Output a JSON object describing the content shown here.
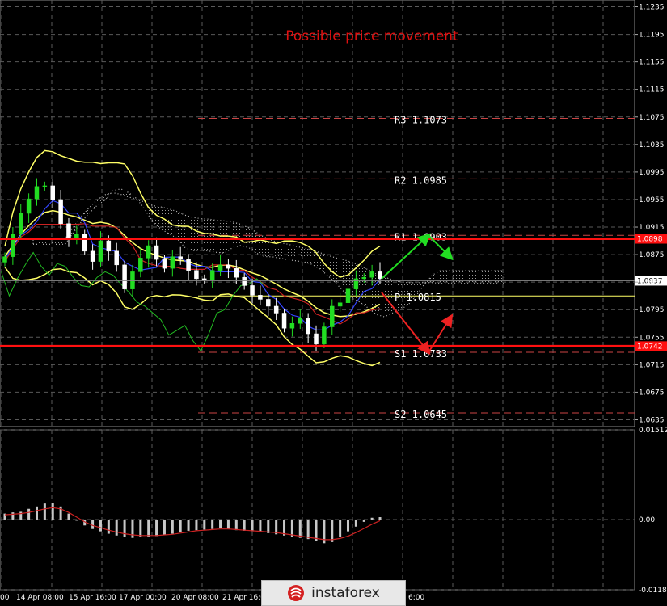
{
  "title": "Possible price movement",
  "colors": {
    "background": "#000000",
    "grid": "#5a5a5a",
    "axis_text": "#ffffff",
    "bull_candle": "#22dd22",
    "bear_candle": "#ffffff",
    "bollinger": "#ffff66",
    "kijun": "#cc2222",
    "tenkan": "#3344ff",
    "chikou": "#22bb22",
    "cloud": "#bbbbbb",
    "pivot_line": "#cc4444",
    "pivot_P": "#ffff66",
    "level_line": "#ff1010",
    "arrow_up": "#22dd22",
    "arrow_down": "#ee2222",
    "osma_bar": "#c8c8c8",
    "osma_signal": "#cc2222"
  },
  "chart_data": [
    {
      "type": "candlestick",
      "title": "Possible price movement",
      "y_ticks": [
        "1.1235",
        "1.1195",
        "1.1155",
        "1.1115",
        "1.1075",
        "1.1035",
        "1.0995",
        "1.0955",
        "1.0915",
        "1.0875",
        "1.0835",
        "1.0795",
        "1.0755",
        "1.0715",
        "1.0675",
        "1.0635"
      ],
      "ylim": [
        1.0625,
        1.1245
      ],
      "x_ticks": [
        "00",
        "14 Apr 08:00",
        "15 Apr 16:00",
        "17 Apr 00:00",
        "20 Apr 08:00",
        "21 Apr 16:00",
        "6:00"
      ],
      "current_price": "1.0837",
      "marked_levels": [
        {
          "label": "1.0898",
          "value": 1.0898
        },
        {
          "label": "1.0742",
          "value": 1.0742
        }
      ],
      "pivot_levels": [
        {
          "name": "R3",
          "value": "1.1073"
        },
        {
          "name": "R2",
          "value": "1.0985"
        },
        {
          "name": "R1",
          "value": "1.0903"
        },
        {
          "name": "P",
          "value": "1.0815"
        },
        {
          "name": "S1",
          "value": "1.0733"
        },
        {
          "name": "S2",
          "value": "1.0645"
        }
      ],
      "close_prices": [
        1.0872,
        1.0905,
        1.0935,
        1.0956,
        1.0974,
        1.0975,
        1.0955,
        1.092,
        1.09,
        1.0905,
        1.088,
        1.0865,
        1.0895,
        1.088,
        1.086,
        1.0825,
        1.085,
        1.087,
        1.0888,
        1.0868,
        1.0855,
        1.0872,
        1.0868,
        1.0852,
        1.084,
        1.0838,
        1.0852,
        1.086,
        1.0855,
        1.0842,
        1.083,
        1.0816,
        1.081,
        1.08,
        1.079,
        1.0768,
        1.0775,
        1.0782,
        1.076,
        1.0745,
        1.077,
        1.08,
        1.0805,
        1.0825,
        1.084,
        1.0842,
        1.085,
        1.084
      ],
      "forecast": [
        {
          "direction": "up",
          "from": 1.084,
          "to": 1.0903,
          "then": 1.087
        },
        {
          "direction": "down",
          "from": 1.082,
          "to": 1.0733,
          "then": 1.0785
        }
      ]
    },
    {
      "type": "bar",
      "title": "",
      "y_ticks": [
        "0.01512",
        "0.00",
        "-0.01186"
      ],
      "ylim": [
        -0.01186,
        0.01512
      ],
      "values": [
        0.001,
        0.0012,
        0.0013,
        0.0018,
        0.0022,
        0.0027,
        0.0028,
        0.0022,
        0.001,
        -0.0002,
        -0.001,
        -0.0016,
        -0.002,
        -0.0024,
        -0.0027,
        -0.003,
        -0.0031,
        -0.003,
        -0.0029,
        -0.0028,
        -0.0026,
        -0.0024,
        -0.0021,
        -0.0019,
        -0.0018,
        -0.0017,
        -0.0016,
        -0.0015,
        -0.0016,
        -0.0018,
        -0.0019,
        -0.002,
        -0.0021,
        -0.0023,
        -0.0025,
        -0.0027,
        -0.0029,
        -0.0031,
        -0.0033,
        -0.0036,
        -0.004,
        -0.0038,
        -0.003,
        -0.002,
        -0.0012,
        -0.0004,
        0.0003,
        0.0004
      ],
      "signal": [
        0.0008,
        0.0009,
        0.001,
        0.0012,
        0.0015,
        0.0018,
        0.002,
        0.0018,
        0.0012,
        0.0004,
        -0.0004,
        -0.001,
        -0.0014,
        -0.0018,
        -0.0021,
        -0.0024,
        -0.0026,
        -0.0027,
        -0.0027,
        -0.0027,
        -0.0026,
        -0.0025,
        -0.0023,
        -0.0021,
        -0.0019,
        -0.0018,
        -0.0017,
        -0.0016,
        -0.0016,
        -0.0017,
        -0.0018,
        -0.0019,
        -0.002,
        -0.0021,
        -0.0022,
        -0.0024,
        -0.0026,
        -0.0028,
        -0.003,
        -0.0032,
        -0.0034,
        -0.0034,
        -0.0032,
        -0.0028,
        -0.0022,
        -0.0015,
        -0.0008,
        -0.0002
      ]
    }
  ],
  "watermark": {
    "text": "instaforex",
    "icon": "instaforex-logo-icon"
  }
}
